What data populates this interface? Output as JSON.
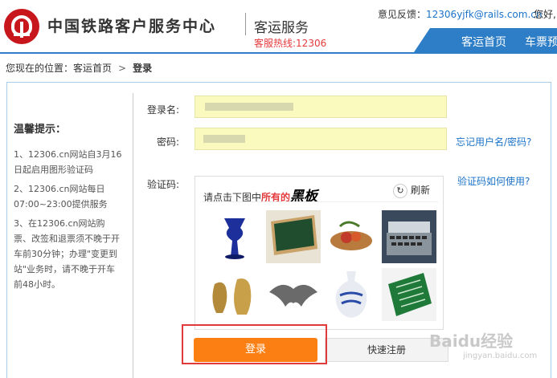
{
  "header": {
    "brand": "中国铁路客户服务中心",
    "service": "客运服务",
    "hotline": "客服热线:12306",
    "feedback_label": "意见反馈：",
    "feedback_email": "12306yjfk@rails.com.cn",
    "greeting": "您好,",
    "nav": [
      "客运首页",
      "车票预"
    ]
  },
  "breadcrumb": {
    "prefix": "您现在的位置：",
    "home": "客运首页",
    "separator": ">",
    "current": "登录"
  },
  "tips": {
    "title": "温馨提示：",
    "items": [
      "1、12306.cn网站自3月16日起启用图形验证码",
      "2、12306.cn网站每日07:00~23:00提供服务",
      "3、在12306.cn网站购票、改签和退票须不晚于开车前30分钟；办理\"变更到站\"业务时，请不晚于开车前48小时。"
    ]
  },
  "form": {
    "username_label": "登录名:",
    "password_label": "密码:",
    "captcha_label": "验证码:",
    "forgot_link": "忘记用户名/密码?",
    "captcha_help": "验证码如何使用?",
    "captcha_prompt_a": "请点击下图中",
    "captcha_prompt_b": "所有的",
    "captcha_word": "黑板",
    "refresh": "刷新",
    "login": "登录",
    "register": "快速注册"
  },
  "watermark": {
    "text": "Baidu经验",
    "sub": "jingyan.baidu.com"
  },
  "colors": {
    "accent": "#2d7dc7",
    "brand_red": "#c8161d",
    "login_orange": "#fb7f12",
    "input_yellow": "#fafabf",
    "link_blue": "#1c73c8"
  }
}
